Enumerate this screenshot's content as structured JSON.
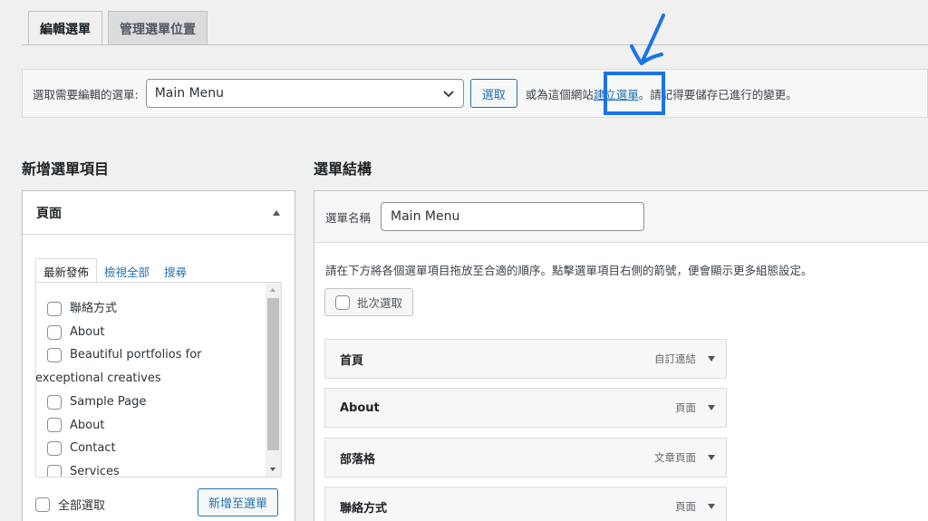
{
  "tabs": {
    "edit": "編輯選單",
    "manage": "管理選單位置"
  },
  "select_bar": {
    "label": "選取需要編輯的選單:",
    "selected_menu": "Main Menu",
    "select_button": "選取",
    "text_before": "或為這個網站",
    "create_link": "建立選單",
    "text_after": "。請記得要儲存已進行的變更。"
  },
  "left": {
    "heading": "新增選單項目",
    "panel_title": "頁面",
    "subtabs": [
      "最新發佈",
      "檢視全部",
      "搜尋"
    ],
    "items": [
      "聯絡方式",
      "About",
      "Beautiful portfolios for",
      "exceptional creatives",
      "Sample Page",
      "About",
      "Contact",
      "Services"
    ],
    "select_all": "全部選取",
    "add_button": "新增至選單"
  },
  "right": {
    "heading": "選單結構",
    "name_label": "選單名稱",
    "name_value": "Main Menu",
    "instructions": "請在下方將各個選單項目拖放至合適的順序。點擊選單項目右側的箭號，便會顯示更多組態設定。",
    "bulk_select": "批次選取",
    "menu_items": [
      {
        "title": "首頁",
        "type": "自訂連結"
      },
      {
        "title": "About",
        "type": "頁面"
      },
      {
        "title": "部落格",
        "type": "文章頁面"
      },
      {
        "title": "聯絡方式",
        "type": "頁面"
      }
    ]
  },
  "colors": {
    "accent": "#2271b1",
    "highlight": "#1a73e8",
    "background": "#f0f0f1"
  },
  "icons": [
    "chevron-down-icon",
    "arrow-annotation-icon",
    "caret-up-icon",
    "caret-down-icon",
    "checkbox-icon"
  ]
}
